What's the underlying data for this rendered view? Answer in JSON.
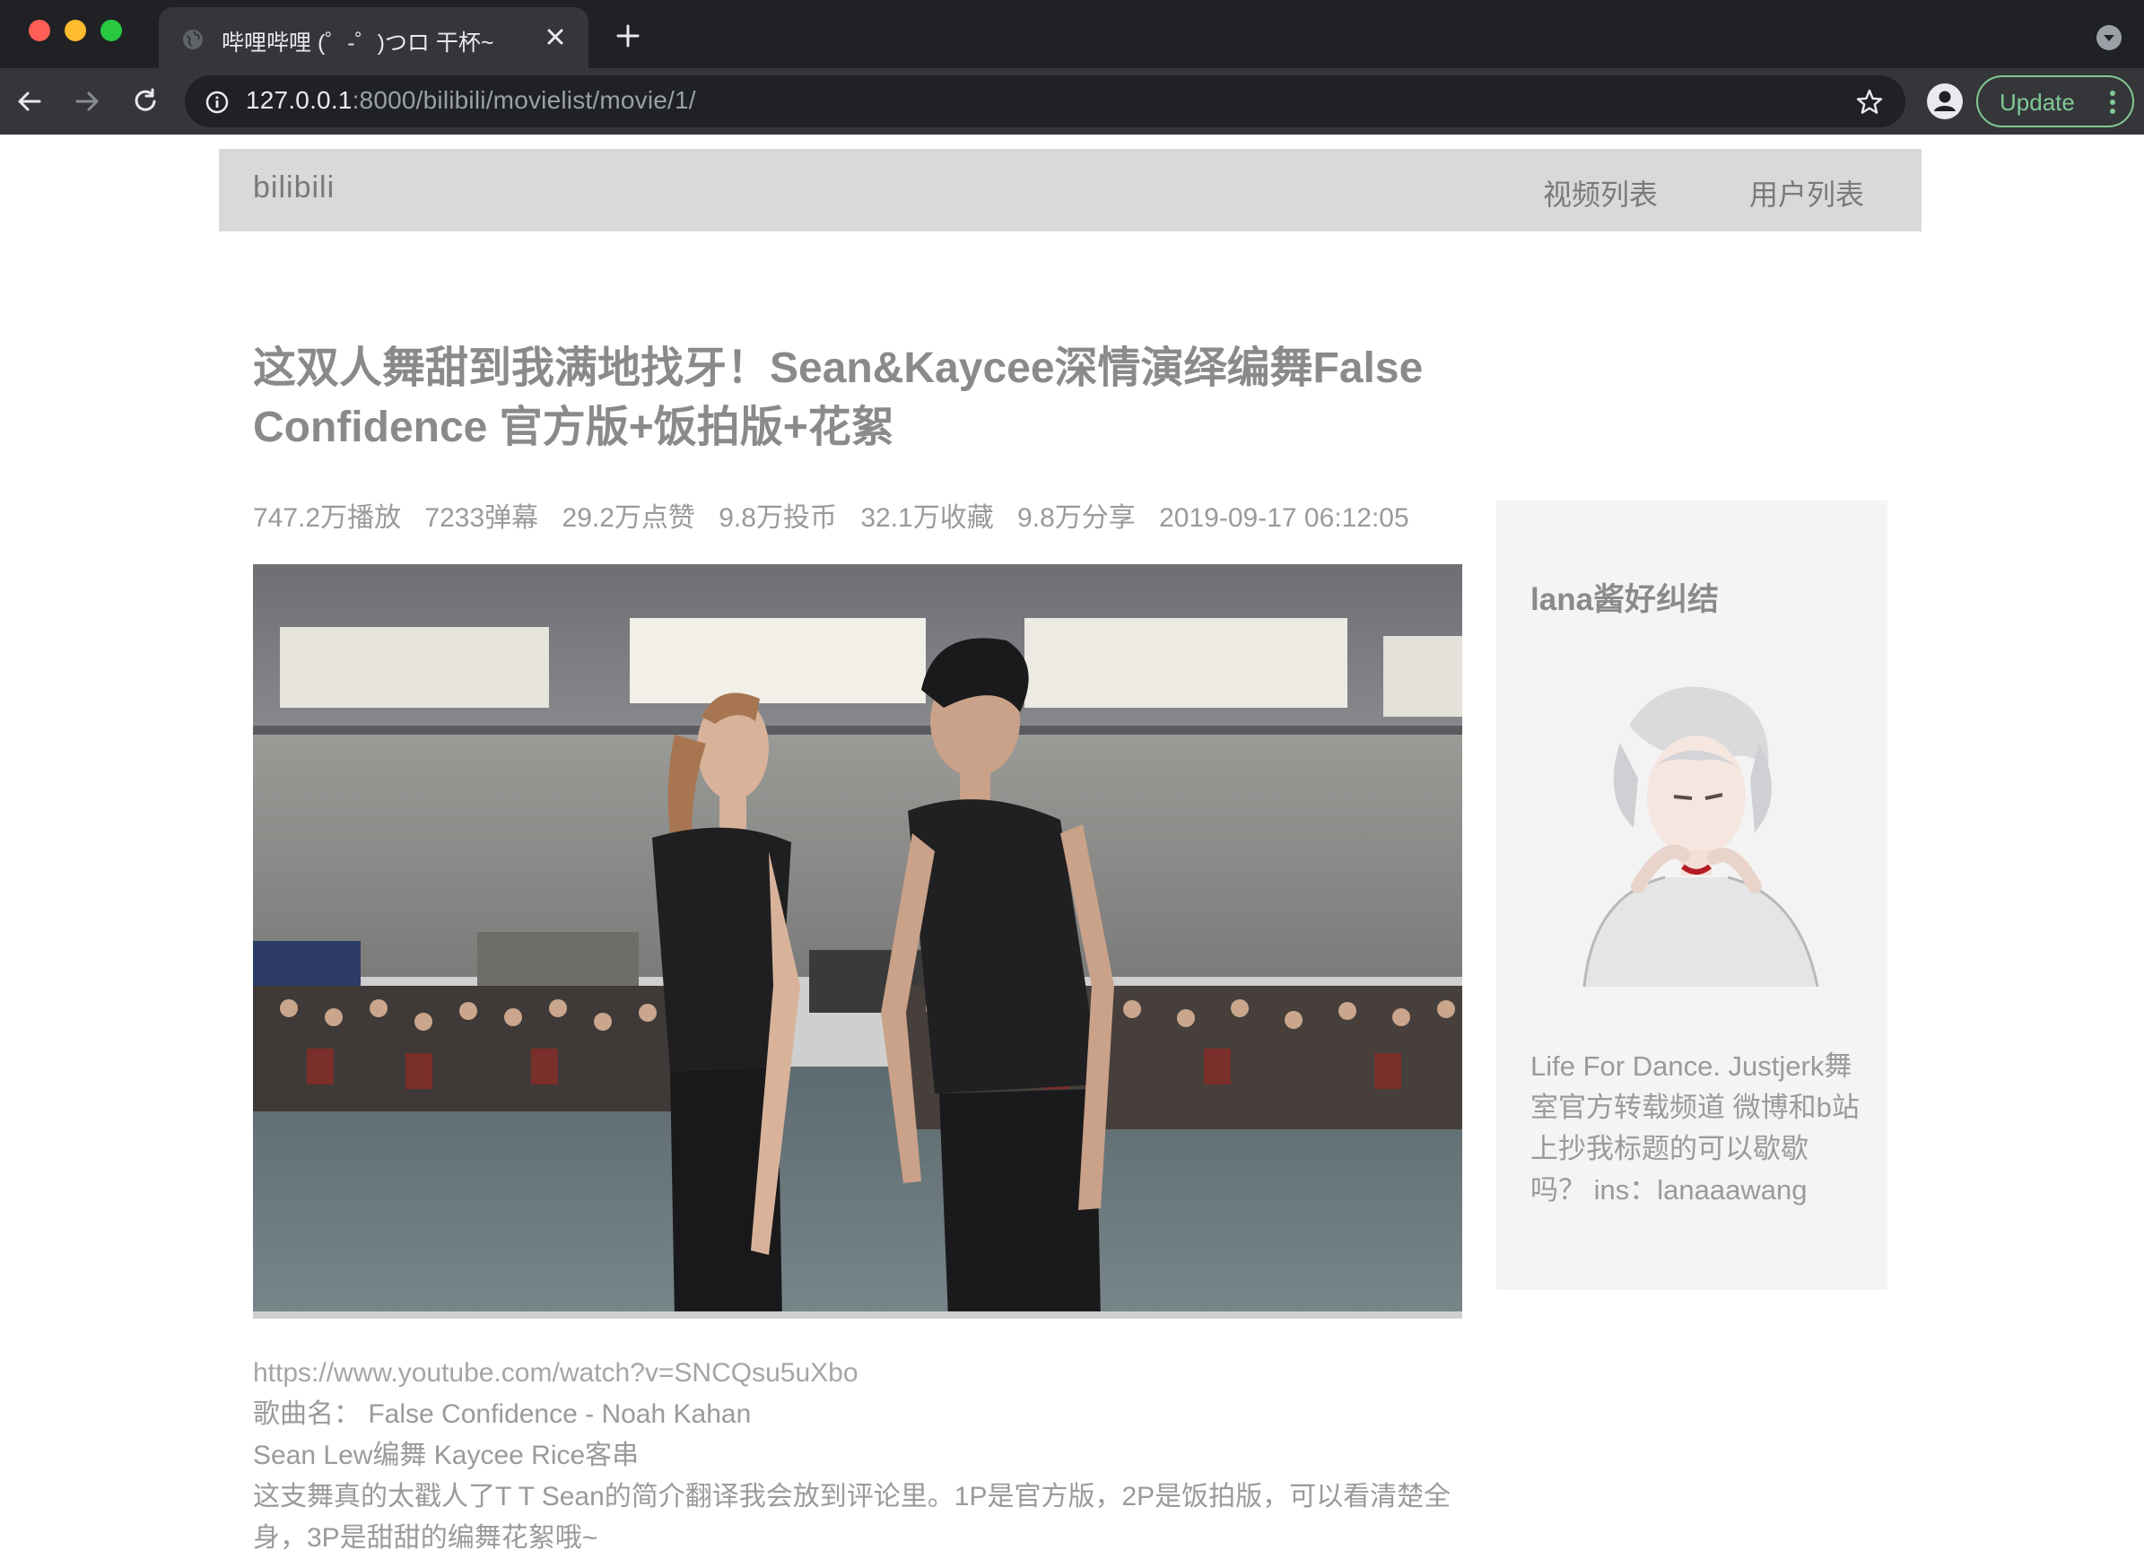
{
  "browser": {
    "tab": {
      "title": "哔哩哔哩 (゜-゜)つロ 干杯~"
    },
    "address_bar": {
      "host": "127.0.0.1",
      "path": ":8000/bilibili/movielist/movie/1/"
    },
    "update_button": {
      "label": "Update"
    },
    "icons": [
      "globe-icon",
      "close-icon",
      "plus-icon",
      "back-arrow-icon",
      "forward-arrow-icon",
      "reload-icon",
      "info-icon",
      "star-icon",
      "profile-icon",
      "kebab-menu-icon",
      "chevron-down-icon"
    ]
  },
  "site_nav": {
    "brand": "bilibili",
    "links": [
      {
        "label": "视频列表"
      },
      {
        "label": "用户列表"
      }
    ]
  },
  "video": {
    "title": "这双人舞甜到我满地找牙！Sean&Kaycee深情演绎编舞False Confidence 官方版+饭拍版+花絮",
    "stats": {
      "plays": "747.2万播放",
      "danmaku": "7233弹幕",
      "likes": "29.2万点赞",
      "coins": "9.8万投币",
      "favorites": "32.1万收藏",
      "shares": "9.8万分享",
      "published": "2019-09-17 06:12:05"
    },
    "description": {
      "link": "https://www.youtube.com/watch?v=SNCQsu5uXbo",
      "song": "歌曲名： False Confidence - Noah Kahan",
      "credits": "Sean Lew编舞 Kaycee Rice客串",
      "note": "这支舞真的太戳人了T T Sean的简介翻译我会放到评论里。1P是官方版，2P是饭拍版，可以看清楚全身，3P是甜甜的编舞花絮哦~"
    }
  },
  "uploader": {
    "name": "lana酱好纠结",
    "bio": "Life For Dance. Justjerk舞室官方转载频道 微博和b站上抄我标题的可以歇歇吗？ ins：lanaaawang"
  }
}
